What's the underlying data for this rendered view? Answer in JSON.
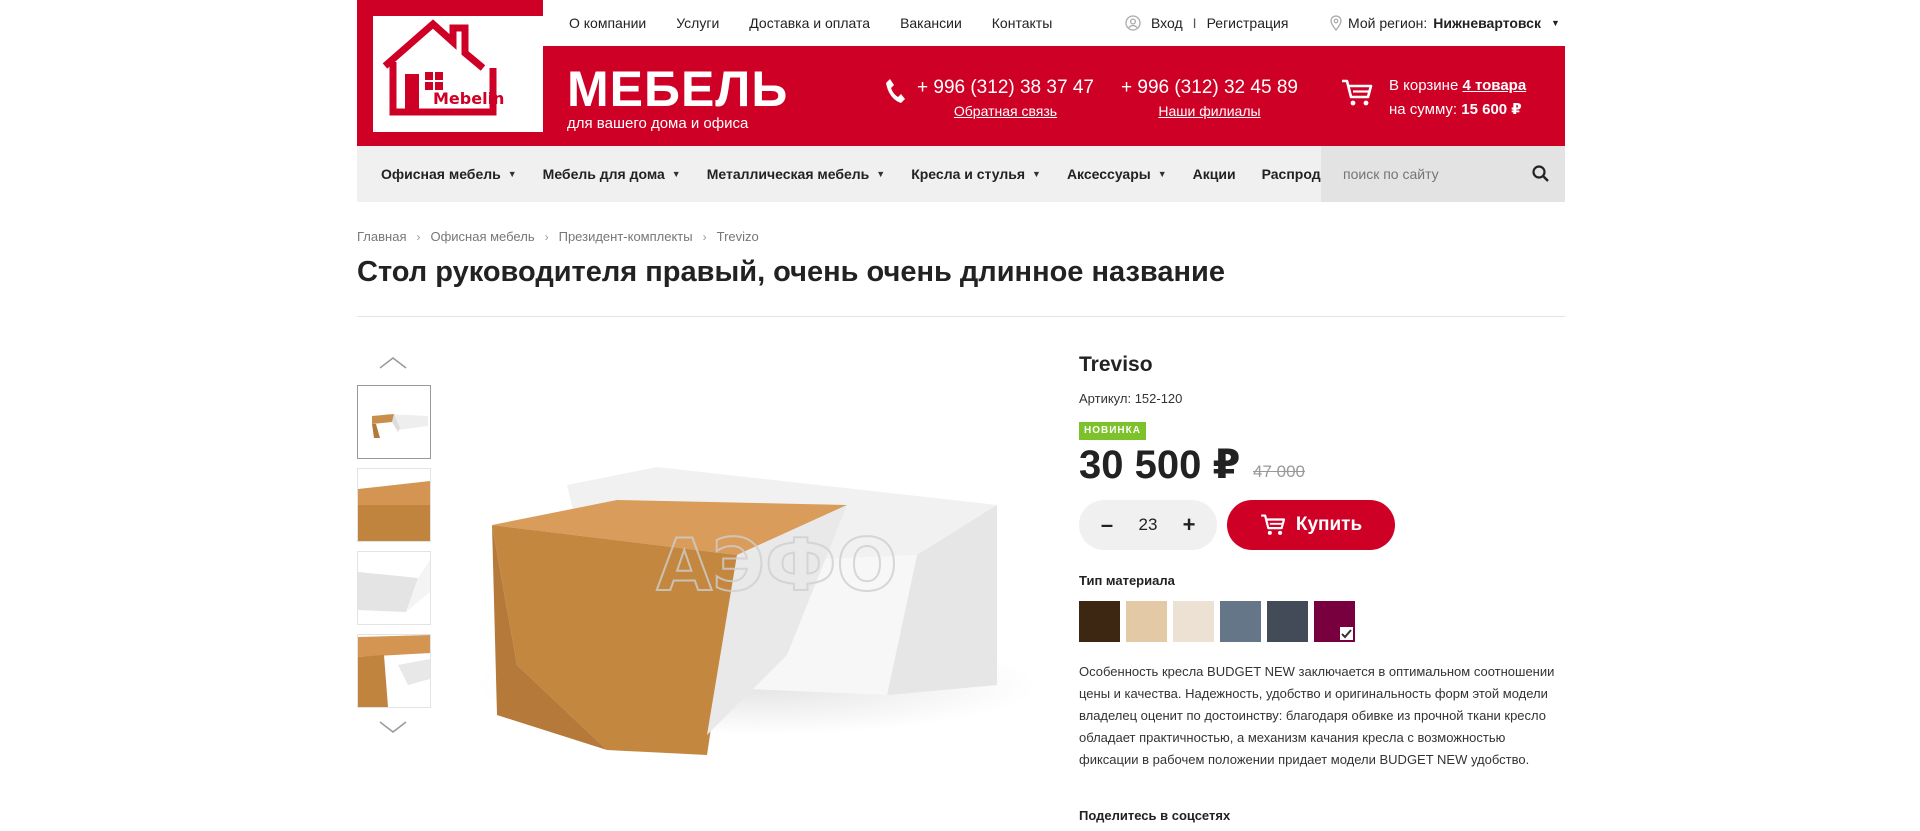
{
  "topnav": [
    "О компании",
    "Услуги",
    "Доставка и оплата",
    "Вакансии",
    "Контакты"
  ],
  "auth": {
    "login": "Вход",
    "separator": "I",
    "register": "Регистрация"
  },
  "region": {
    "label": "Мой регион:",
    "value": "Нижневартовск"
  },
  "logo": {
    "text": "Mebelin"
  },
  "brand": {
    "title": "МЕБЕЛЬ",
    "subtitle": "для вашего дома и офиса"
  },
  "phones": [
    {
      "number": "+ 996 (312) 38 37 47",
      "link": "Обратная связь"
    },
    {
      "number": "+ 996 (312) 32 45 89",
      "link": "Наши филиалы"
    }
  ],
  "cart": {
    "line1": "В корзине",
    "count": "4 товара",
    "line2": "на сумму:",
    "sum": "15 600 ₽"
  },
  "menu": [
    {
      "label": "Офисная мебель",
      "dropdown": true
    },
    {
      "label": "Мебель для дома",
      "dropdown": true
    },
    {
      "label": "Металлическая мебель",
      "dropdown": true
    },
    {
      "label": "Кресла и стулья",
      "dropdown": true
    },
    {
      "label": "Аксессуары",
      "dropdown": true
    },
    {
      "label": "Акции",
      "dropdown": false
    },
    {
      "label": "Распродажа",
      "dropdown": false
    }
  ],
  "search": {
    "placeholder": "поиск по сайту"
  },
  "breadcrumbs": [
    "Главная",
    "Офисная мебель",
    "Президент-комплекты",
    "Trevizo"
  ],
  "page_title": "Стол руководителя правый, очень очень длинное название",
  "watermark": "АЭФО",
  "product": {
    "name": "Treviso",
    "sku": "Артикул: 152-120",
    "badge": "НОВИНКА",
    "price": "30 500 ₽",
    "old_price": "47 000",
    "quantity": "23",
    "buy_label": "Купить",
    "material_label": "Тип материала",
    "swatches": [
      "#3d2712",
      "#e4c9a7",
      "#ece1d3",
      "#667689",
      "#434b58",
      "#78003f"
    ],
    "selected_swatch": 5,
    "description": "Особенность кресла BUDGET NEW заключается в оптимальном соотношении цены и качества. Надежность, удобство и оригинальность форм этой модели владелец оценит по достоинству: благодаря обивке из прочной ткани кресло обладает практичностью, а механизм качания кресла с возможностью фиксации в рабочем положении придает модели BUDGET NEW удобство.",
    "share_label": "Поделитесь в соцсетях"
  },
  "colors": {
    "brand_red": "#cf0025",
    "new_badge": "#7dc22b"
  }
}
